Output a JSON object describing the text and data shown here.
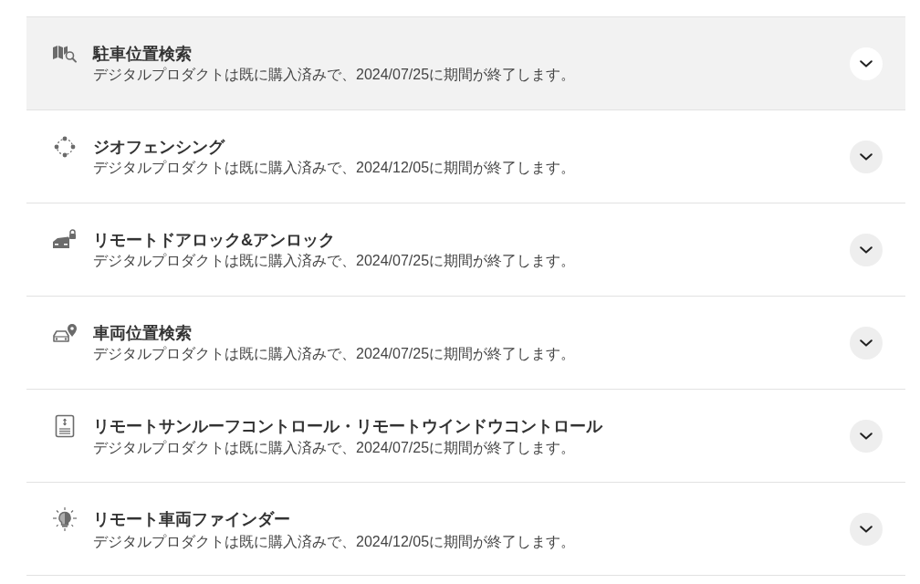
{
  "products": [
    {
      "title": "駐車位置検索",
      "description": "デジタルプロダクトは既に購入済みで、2024/07/25に期間が終了します。",
      "selected": true,
      "expanded": false
    },
    {
      "title": "ジオフェンシング",
      "description": "デジタルプロダクトは既に購入済みで、2024/12/05に期間が終了します。",
      "selected": false,
      "expanded": false
    },
    {
      "title": "リモートドアロック&アンロック",
      "description": "デジタルプロダクトは既に購入済みで、2024/07/25に期間が終了します。",
      "selected": false,
      "expanded": false
    },
    {
      "title": "車両位置検索",
      "description": "デジタルプロダクトは既に購入済みで、2024/07/25に期間が終了します。",
      "selected": false,
      "expanded": false
    },
    {
      "title": "リモートサンルーフコントロール・リモートウインドウコントロール",
      "description": "デジタルプロダクトは既に購入済みで、2024/07/25に期間が終了します。",
      "selected": false,
      "expanded": false
    },
    {
      "title": "リモート車両ファインダー",
      "description": "デジタルプロダクトは既に購入済みで、2024/12/05に期間が終了します。",
      "selected": false,
      "expanded": false
    }
  ]
}
